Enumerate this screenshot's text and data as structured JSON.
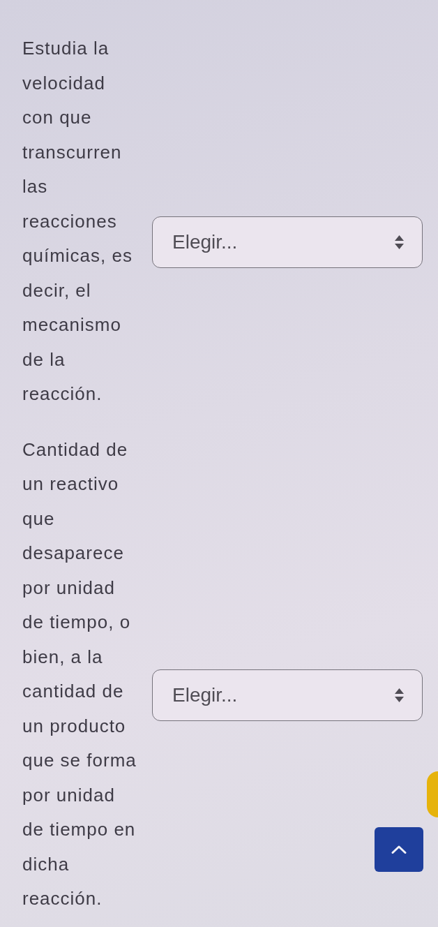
{
  "rows": [
    {
      "prompt": "Estudia la velocidad con que transcurren las reacciones químicas, es decir, el mecanismo de la reacción.",
      "dropdown": {
        "value": "Elegir..."
      }
    },
    {
      "prompt": "Cantidad de un reactivo que desaparece por unidad de tiempo, o bien, a la cantidad de un producto que se forma por unidad de tiempo en dicha reacción.",
      "dropdown": {
        "value": "Elegir..."
      }
    }
  ],
  "floating": [
    {
      "kind": "edge-circle"
    },
    {
      "kind": "back-to-top"
    }
  ]
}
